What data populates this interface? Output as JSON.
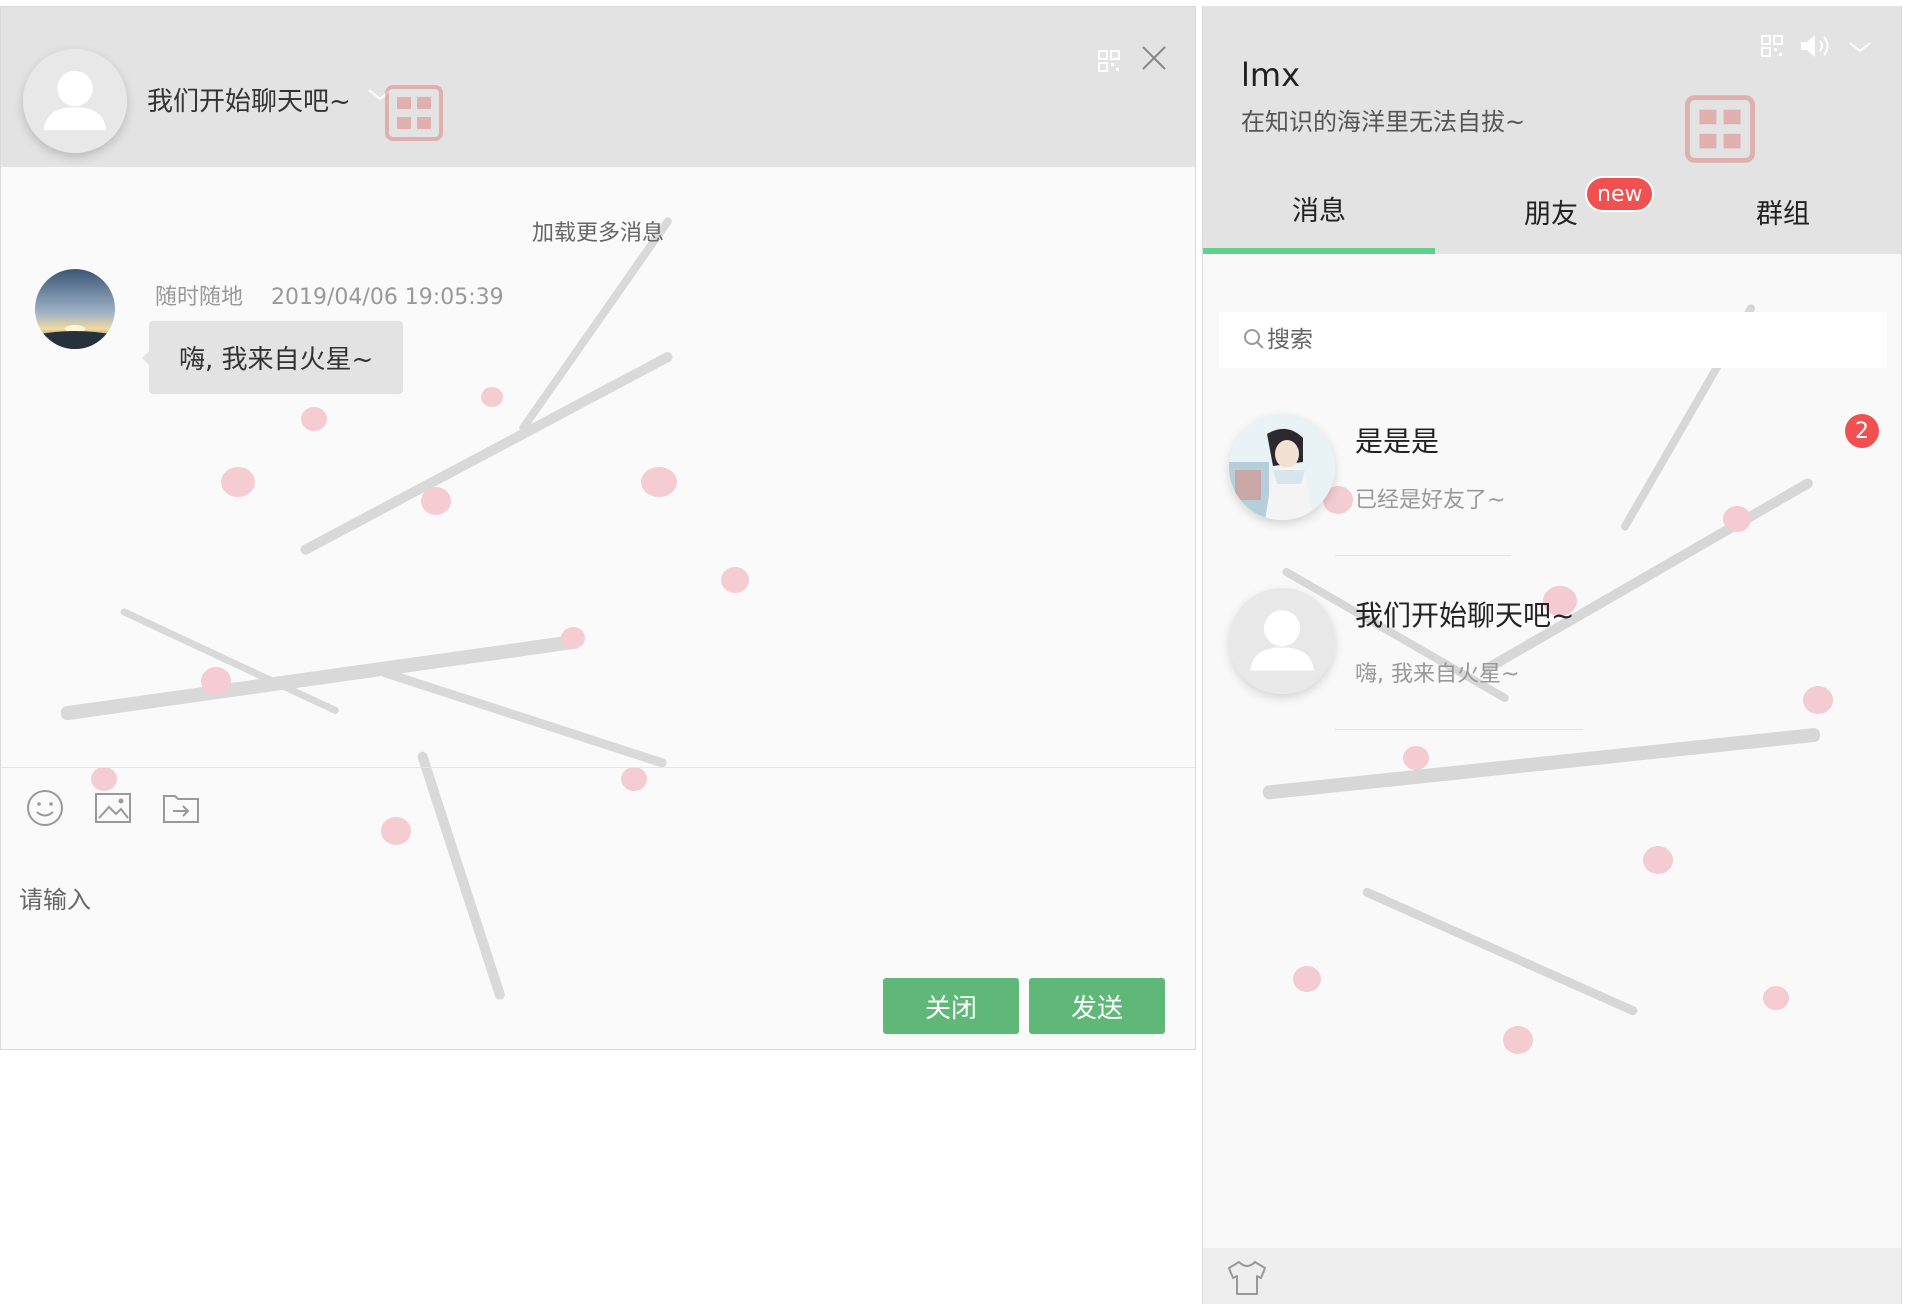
{
  "chat": {
    "title": "我们开始聊天吧~",
    "load_more": "加载更多消息",
    "message": {
      "sender": "随时随地",
      "time": "2019/04/06 19:05:39",
      "text": "嗨, 我来自火星~"
    },
    "input_placeholder": "请输入",
    "close_label": "关闭",
    "send_label": "发送"
  },
  "panel": {
    "user_name": "lmx",
    "signature": "在知识的海洋里无法自拔~",
    "tabs": [
      {
        "label": "消息",
        "active": true
      },
      {
        "label": "朋友",
        "active": false
      },
      {
        "label": "群组",
        "active": false
      }
    ],
    "new_badge": "new",
    "search_placeholder": "搜索",
    "conversations": [
      {
        "name": "是是是",
        "preview": "已经是好友了~",
        "unread": "2"
      },
      {
        "name": "我们开始聊天吧~",
        "preview": "嗨, 我来自火星~",
        "unread": ""
      }
    ]
  },
  "icons": {
    "emoji": "emoji-icon",
    "image": "image-icon",
    "file": "file-icon",
    "qrcode": "qrcode-icon",
    "close": "close-icon",
    "sound": "sound-icon",
    "chevron": "chevron-down-icon",
    "search": "search-icon",
    "skin": "shirt-icon"
  },
  "colors": {
    "accent_green": "#5fb878",
    "tab_indicator": "#5fd18b",
    "badge_red": "#f05050",
    "header_gray": "#e3e3e3"
  }
}
